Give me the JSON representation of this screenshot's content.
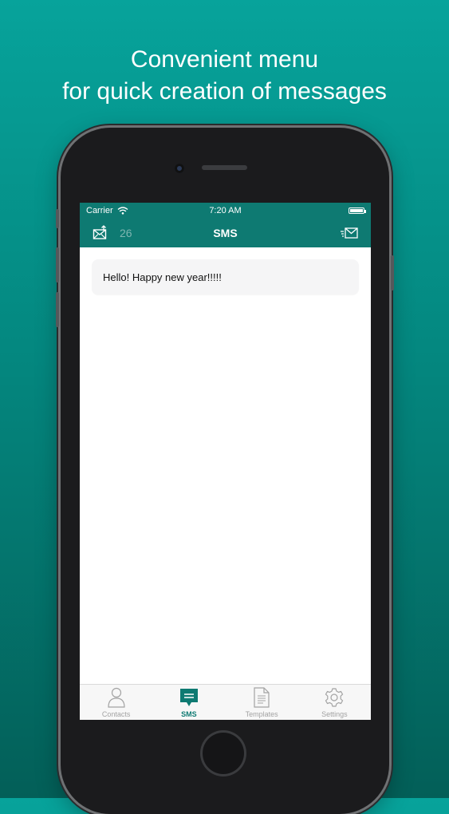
{
  "headline": {
    "line1": "Convenient menu",
    "line2": "for quick creation of messages"
  },
  "status_bar": {
    "carrier": "Carrier",
    "time": "7:20 AM"
  },
  "nav_bar": {
    "count": "26",
    "title": "SMS",
    "left_icon": "mail-badge-icon",
    "right_icon": "send-mail-icon"
  },
  "messages": [
    {
      "text": "Hello! Happy new year!!!!!"
    }
  ],
  "tab_bar": {
    "tabs": [
      {
        "label": "Contacts",
        "icon": "person-icon",
        "active": false
      },
      {
        "label": "SMS",
        "icon": "message-icon",
        "active": true
      },
      {
        "label": "Templates",
        "icon": "document-icon",
        "active": false
      },
      {
        "label": "Settings",
        "icon": "gear-icon",
        "active": false
      }
    ]
  },
  "colors": {
    "background_top": "#07a39b",
    "background_bottom": "#035f58",
    "brand": "#0e7a72",
    "inactive_tab": "#a3a3a3"
  }
}
